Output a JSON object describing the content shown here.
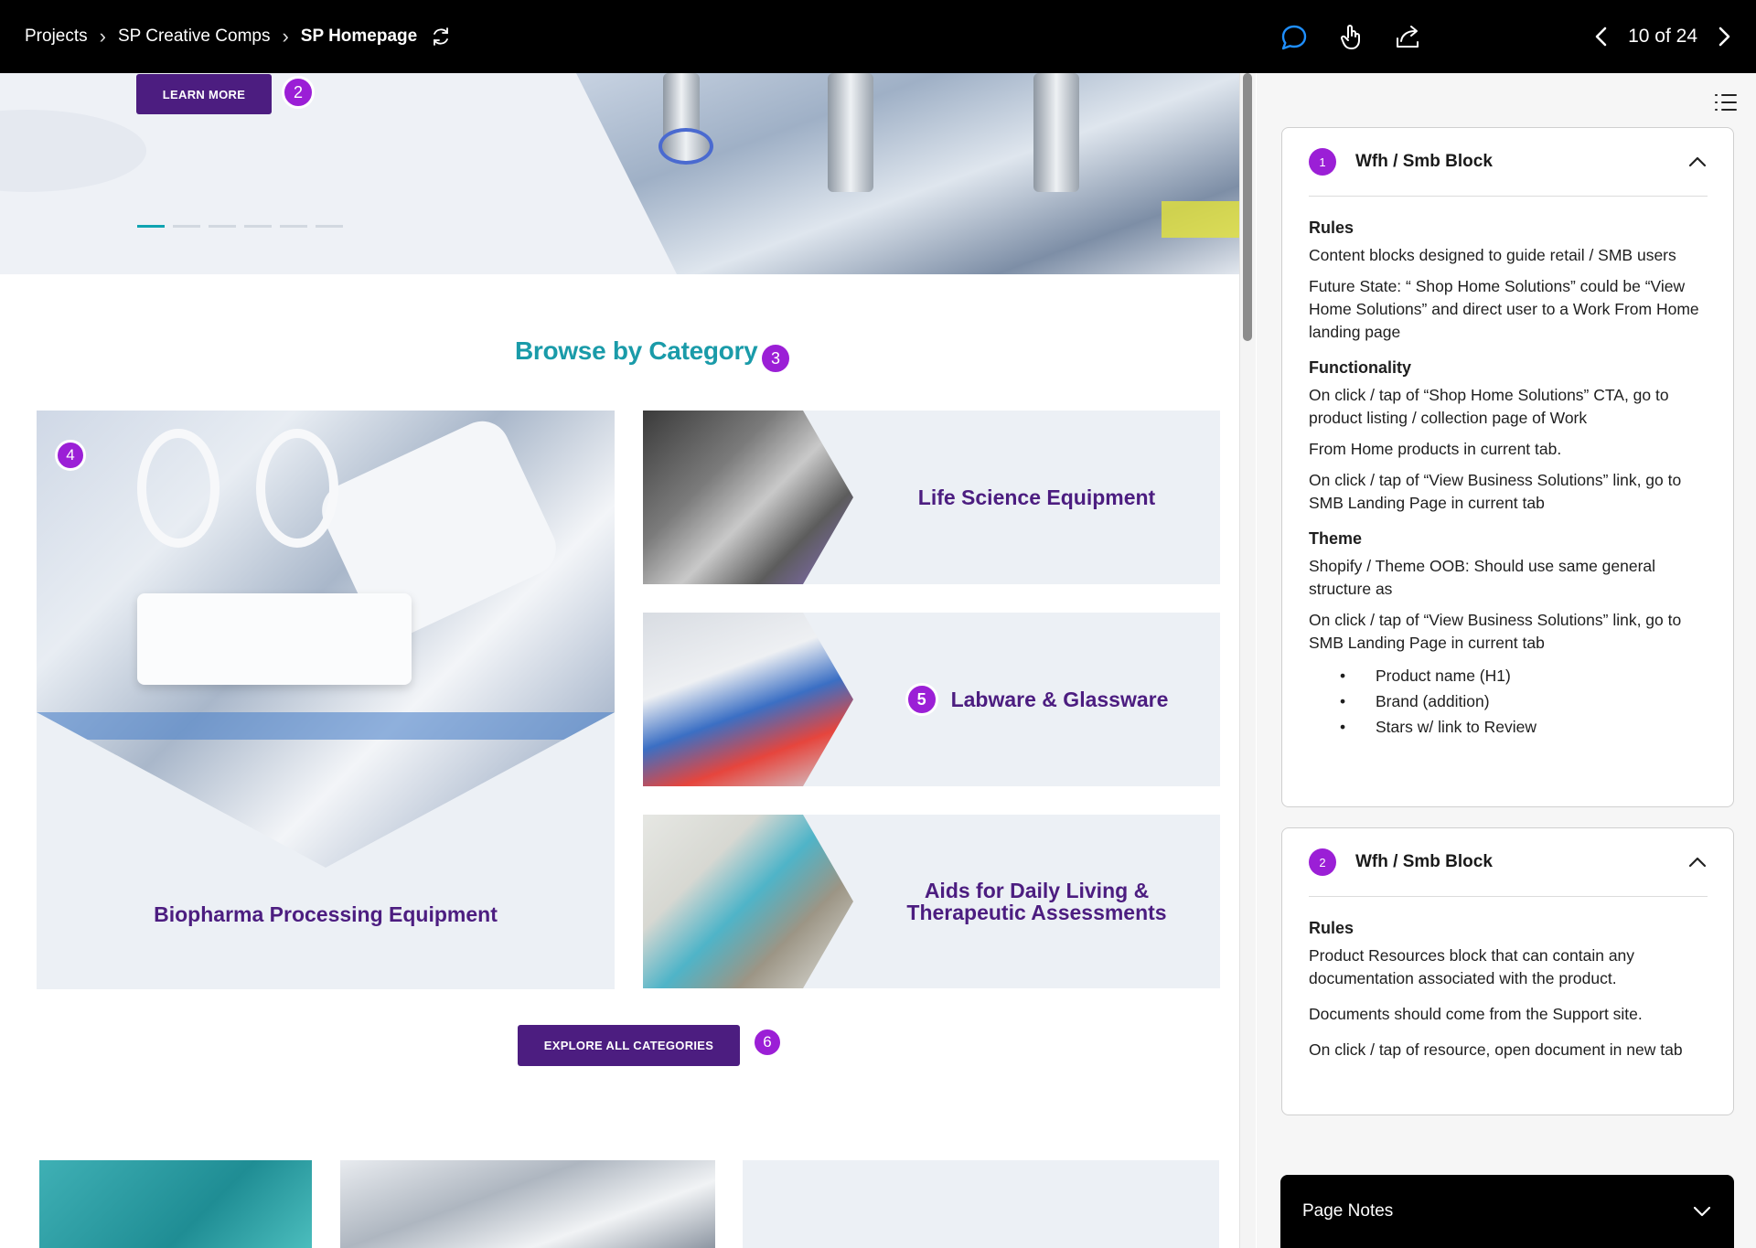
{
  "topbar": {
    "breadcrumbs": [
      "Projects",
      "SP Creative Comps",
      "SP Homepage"
    ],
    "separator": "›",
    "pager": "10 of 24"
  },
  "hero": {
    "learn_more": "LEARN MORE",
    "badge": "2",
    "active_slide": 1,
    "slide_count": 6
  },
  "category_section": {
    "title": "Browse by Category",
    "title_badge": "3",
    "big": {
      "badge": "4",
      "label": "Biopharma Processing Equipment"
    },
    "items": [
      {
        "label": "Life Science Equipment",
        "badge": ""
      },
      {
        "label": "Labware & Glassware",
        "badge": "5"
      },
      {
        "label_line1": "Aids for Daily Living &",
        "label_line2": "Therapeutic Assessments",
        "badge": ""
      }
    ],
    "explore": "EXPLORE ALL CATEGORIES",
    "explore_badge": "6"
  },
  "panel": {
    "cards": [
      {
        "num": "1",
        "title": "Wfh / Smb Block",
        "rules_heading": "Rules",
        "rules": [
          "Content blocks designed to guide retail / SMB users",
          "Future State: “ Shop Home Solutions” could be “View Home Solutions” and direct user to a Work From Home landing page"
        ],
        "functionality_heading": "Functionality",
        "functionality": [
          "On click / tap of “Shop Home Solutions” CTA, go to product listing / collection page of Work",
          "From Home products in current tab.",
          "On click / tap of “View Business Solutions” link, go to SMB Landing Page in current tab"
        ],
        "theme_heading": "Theme",
        "theme": [
          "Shopify / Theme OOB: Should use same general structure as",
          "On click / tap of “View Business Solutions” link, go to SMB Landing Page in current tab"
        ],
        "bullets": [
          "Product name (H1)",
          "Brand (addition)",
          "Stars w/ link to Review"
        ]
      },
      {
        "num": "2",
        "title": "Wfh / Smb Block",
        "rules_heading": "Rules",
        "rules": [
          "Product Resources block that can contain any documentation associated with the product.",
          "Documents should come from the Support site.",
          "On click / tap of resource, open document in new tab"
        ]
      }
    ],
    "page_notes": "Page Notes"
  },
  "colors": {
    "topbar": "#000000",
    "accent_purple": "#4c1d80",
    "badge_purple": "#9b1fd6",
    "teal": "#1a9ba9",
    "comment_blue": "#1f8fff"
  },
  "icons": [
    "refresh-icon",
    "comment-icon",
    "hand-icon",
    "share-icon",
    "chevron-left-icon",
    "chevron-right-icon",
    "list-icon",
    "chevron-up-icon",
    "chevron-down-icon"
  ]
}
